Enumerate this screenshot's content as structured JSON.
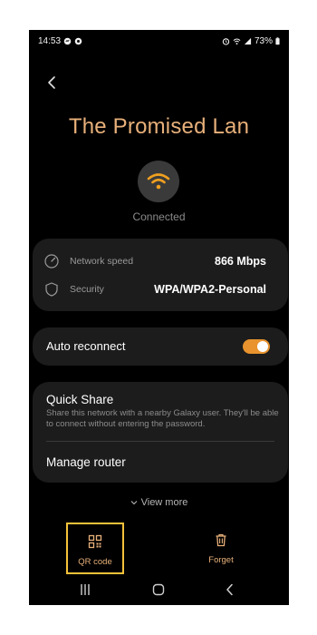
{
  "status_bar": {
    "time": "14:53",
    "battery": "73%"
  },
  "network": {
    "name": "The Promised Lan",
    "status": "Connected"
  },
  "details": {
    "speed_label": "Network speed",
    "speed_value": "866 Mbps",
    "security_label": "Security",
    "security_value": "WPA/WPA2-Personal"
  },
  "auto_reconnect": {
    "label": "Auto reconnect",
    "enabled": true
  },
  "quick_share": {
    "title": "Quick Share",
    "description": "Share this network with a nearby Galaxy user. They'll be able to connect without entering the password."
  },
  "manage_router": {
    "label": "Manage router"
  },
  "view_more": {
    "label": "View more"
  },
  "actions": {
    "qr_code_label": "QR code",
    "forget_label": "Forget"
  },
  "colors": {
    "accent": "#e8b07a",
    "toggle": "#e8932e",
    "highlight": "#f5c23a",
    "card": "#1c1c1c"
  },
  "icons": [
    "chat-bubble-icon",
    "wifi-icon",
    "alarm-icon",
    "signal-icon",
    "battery-icon",
    "chevron-left-icon",
    "speedometer-icon",
    "shield-icon",
    "qr-code-icon",
    "trash-icon",
    "recents-icon",
    "home-icon",
    "back-nav-icon"
  ]
}
